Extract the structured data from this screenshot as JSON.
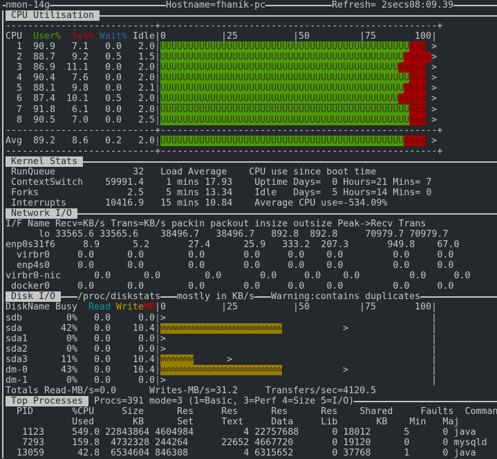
{
  "title_bar": {
    "app": "nmon-14g",
    "hostname": "Hostname=fhanik-pc",
    "refresh": "Refresh= 2secs",
    "time": "08:09.39"
  },
  "cpu": {
    "section_title": "CPU Utilisation",
    "headers": {
      "cpu": "CPU",
      "user": "User%",
      "sys": "Sys%",
      "wait": "Wait%",
      "idle": "Idle"
    },
    "scale": {
      "t0": "0",
      "t25": "25",
      "t50": "50",
      "t75": "75",
      "t100": "100"
    },
    "rows": [
      {
        "cpu": "1",
        "user": "90.9",
        "sys": "7.1",
        "wait": "0.0",
        "idle": "2.0",
        "u_chars": 45,
        "s_chars": 3
      },
      {
        "cpu": "2",
        "user": "88.7",
        "sys": "9.2",
        "wait": "0.5",
        "idle": "1.5",
        "u_chars": 44,
        "s_chars": 5
      },
      {
        "cpu": "3",
        "user": "86.9",
        "sys": "11.1",
        "wait": "0.0",
        "idle": "2.0",
        "u_chars": 43,
        "s_chars": 5
      },
      {
        "cpu": "4",
        "user": "90.4",
        "sys": "7.6",
        "wait": "0.0",
        "idle": "2.0",
        "u_chars": 45,
        "s_chars": 3
      },
      {
        "cpu": "5",
        "user": "88.1",
        "sys": "9.8",
        "wait": "0.0",
        "idle": "2.1",
        "u_chars": 44,
        "s_chars": 4
      },
      {
        "cpu": "6",
        "user": "87.4",
        "sys": "10.1",
        "wait": "0.5",
        "idle": "2.0",
        "u_chars": 43,
        "s_chars": 5
      },
      {
        "cpu": "7",
        "user": "91.8",
        "sys": "6.1",
        "wait": "0.0",
        "idle": "2.0",
        "u_chars": 45,
        "s_chars": 3
      },
      {
        "cpu": "8",
        "user": "90.5",
        "sys": "7.0",
        "wait": "0.0",
        "idle": "2.5",
        "u_chars": 45,
        "s_chars": 3
      }
    ],
    "avg": {
      "cpu": "Avg",
      "user": "89.2",
      "sys": "8.6",
      "wait": "0.2",
      "idle": "2.0",
      "u_chars": 44,
      "s_chars": 4
    },
    "bar_user_char": "U",
    "bar_sys_char": "s",
    "overflow_marker": ">"
  },
  "kernel": {
    "section_title": "Kernel Stats",
    "lines": [
      "RunQueue              32   Load Average    CPU use since boot time",
      "ContextSwitch    59991.4    1 mins 17.93    Uptime Days=  0 Hours=21 Mins= 7",
      "Forks                2.5    5 mins 13.34    Idle   Days=  5 Hours=14 Mins= 0",
      "Interrupts       10416.9   15 mins 10.84    Average CPU use=-534.09%"
    ]
  },
  "network": {
    "section_title": "Network I/O",
    "header": "I/F Name Recv=KB/s Trans=KB/s packin packout insize outsize Peak->Recv Trans",
    "rows": [
      "      lo 33565.6 33565.6    38496.7   38496.7   892.8  892.8     70979.7 70979.7",
      "enp0s31f6     8.9      5.2       27.4      25.9   333.2  207.3       949.8    67.0",
      "  virbr0     0.0      0.0        0.0       0.0     0.0    0.0         0.0     0.0",
      "  enp4s0     0.0      0.0        0.0       0.0     0.0    0.0         0.0     0.0",
      "virbr0-nic      0.0      0.0        0.0       0.0     0.0    0.0         0.0     0.0",
      " docker0     0.0      0.0        0.0       0.0     0.0    0.0         0.0     0.0"
    ]
  },
  "disk": {
    "section_title": "Disk I/O",
    "source": "/proc/diskstats",
    "units_note": "mostly in KB/s",
    "warning": "Warning:contains duplicates",
    "headers": {
      "name": "DiskName",
      "busy": "Busy",
      "read": "Read",
      "write": "Write",
      "mb": "MB"
    },
    "rows": [
      {
        "name": "sdb",
        "busy": "0%",
        "read": "0.0",
        "write": "0.0",
        "w_chars": 0,
        "marker_col": 0
      },
      {
        "name": "sda",
        "busy": "42%",
        "read": "0.0",
        "write": "10.4",
        "w_chars": 22,
        "marker_col": 33
      },
      {
        "name": "sda1",
        "busy": "0%",
        "read": "0.0",
        "write": "0.0",
        "w_chars": 0,
        "marker_col": 0
      },
      {
        "name": "sda2",
        "busy": "0%",
        "read": "0.0",
        "write": "0.0",
        "w_chars": 0,
        "marker_col": 0
      },
      {
        "name": "sda3",
        "busy": "11%",
        "read": "0.0",
        "write": "10.4",
        "w_chars": 6,
        "marker_col": 12
      },
      {
        "name": "dm-0",
        "busy": "43%",
        "read": "0.0",
        "write": "10.4",
        "w_chars": 22,
        "marker_col": 33
      },
      {
        "name": "dm-1",
        "busy": "0%",
        "read": "0.0",
        "write": "0.0",
        "w_chars": 0,
        "marker_col": 0
      }
    ],
    "bar_char": "W",
    "totals": {
      "read": "Totals Read-MB/s=0.0",
      "writes": "Writes-MB/s=31.2",
      "transfers": "Transfers/sec=4120.5"
    }
  },
  "processes": {
    "section_title": "Top Processes",
    "summary": "Procs=391 mode=3 (1=Basic, 3=Perf 4=Size 5=I/O)",
    "header1": "  PID       %CPU     Size      Res     Res      Res      Res    Shared     Faults  Command",
    "header2": "            Used       KB      Set     Text     Data     Lib       KB    Min   Maj",
    "rows": [
      {
        "pid": "1123",
        "cpu": "549.0",
        "size": "22843864",
        "res_set": "4604984",
        "res_text": "4",
        "res_data": "22757688",
        "res_lib": "0",
        "shared": "18012",
        "min": "5",
        "maj": "0",
        "command": "java"
      },
      {
        "pid": "7293",
        "cpu": "159.8",
        "size": "4732328",
        "res_set": "244264",
        "res_text": "22652",
        "res_data": "4667720",
        "res_lib": "0",
        "shared": "19120",
        "min": "0",
        "maj": "0",
        "command": "mysqld"
      },
      {
        "pid": "13059",
        "cpu": "42.8",
        "size": "6534604",
        "res_set": "846308",
        "res_text": "4",
        "res_data": "6315652",
        "res_lib": "0",
        "shared": "37768",
        "min": "1",
        "maj": "0",
        "command": "java"
      }
    ]
  }
}
